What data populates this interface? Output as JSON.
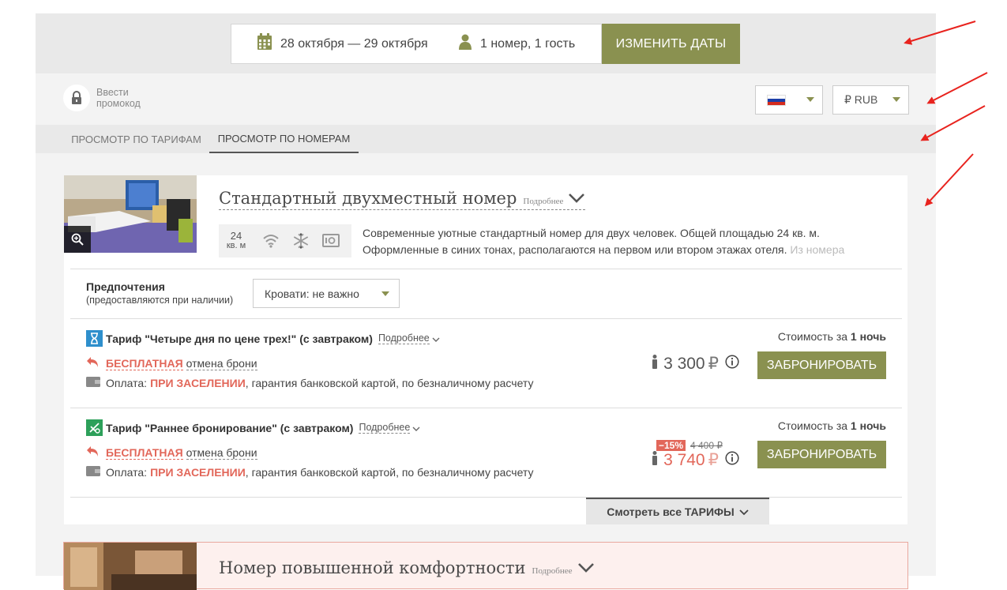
{
  "search": {
    "dates": "28 октября — 29 октября",
    "guests": "1 номер, 1 гость",
    "change_button": "ИЗМЕНИТЬ ДАТЫ"
  },
  "promo": {
    "line1": "Ввести",
    "line2": "промокод"
  },
  "currency": {
    "selected": "₽ RUB"
  },
  "tabs": [
    {
      "label": "ПРОСМОТР ПО ТАРИФАМ",
      "active": false
    },
    {
      "label": "ПРОСМОТР ПО НОМЕРАМ",
      "active": true
    }
  ],
  "rooms": [
    {
      "title": "Стандартный двухместный номер",
      "more": "Подробнее",
      "area_value": "24",
      "area_unit": "кв. м",
      "amenities": [
        "wifi-icon",
        "snowflake-icon",
        "safe-icon"
      ],
      "description_line1": "Современные уютные стандартный номер для двух человек. Общей площадью 24 кв. м.",
      "description_line2": "Оформленные в синих тонах, располагаются на первом или втором этажах отеля.",
      "description_fade": "Из номера",
      "preferences_title": "Предпочтения",
      "preferences_sub": "(предоставляются при наличии)",
      "bed_select": "Кровати: не важно",
      "rates": [
        {
          "name": "Тариф \"Четыре дня по цене трех!\" (с завтраком)",
          "more": "Подробнее",
          "cancel_free": "БЕСПЛАТНАЯ",
          "cancel_text": "отмена брони",
          "pay_prefix": "Оплата:",
          "pay_when": "ПРИ ЗАСЕЛЕНИИ",
          "pay_rest": ", гарантия банковской картой, по безналичному расчету",
          "cost_for": "Стоимость за",
          "nights": "1 ночь",
          "price": "3 300",
          "currency_sign": "₽",
          "book": "ЗАБРОНИРОВАТЬ"
        },
        {
          "name": "Тариф \"Раннее бронирование\" (с завтраком)",
          "more": "Подробнее",
          "cancel_free": "БЕСПЛАТНАЯ",
          "cancel_text": "отмена брони",
          "pay_prefix": "Оплата:",
          "pay_when": "ПРИ ЗАСЕЛЕНИИ",
          "pay_rest": ", гарантия банковской картой, по безналичному расчету",
          "cost_for": "Стоимость за",
          "nights": "1 ночь",
          "discount": "−15%",
          "old_price": "4 400 ₽",
          "price": "3 740",
          "currency_sign": "₽",
          "book": "ЗАБРОНИРОВАТЬ"
        }
      ],
      "see_all": "Смотреть все ТАРИФЫ"
    },
    {
      "title": "Номер повышенной комфортности",
      "more": "Подробнее"
    }
  ],
  "colors": {
    "accent": "#8a9150",
    "highlight": "#e2675a",
    "arrow": "#e8231e"
  }
}
